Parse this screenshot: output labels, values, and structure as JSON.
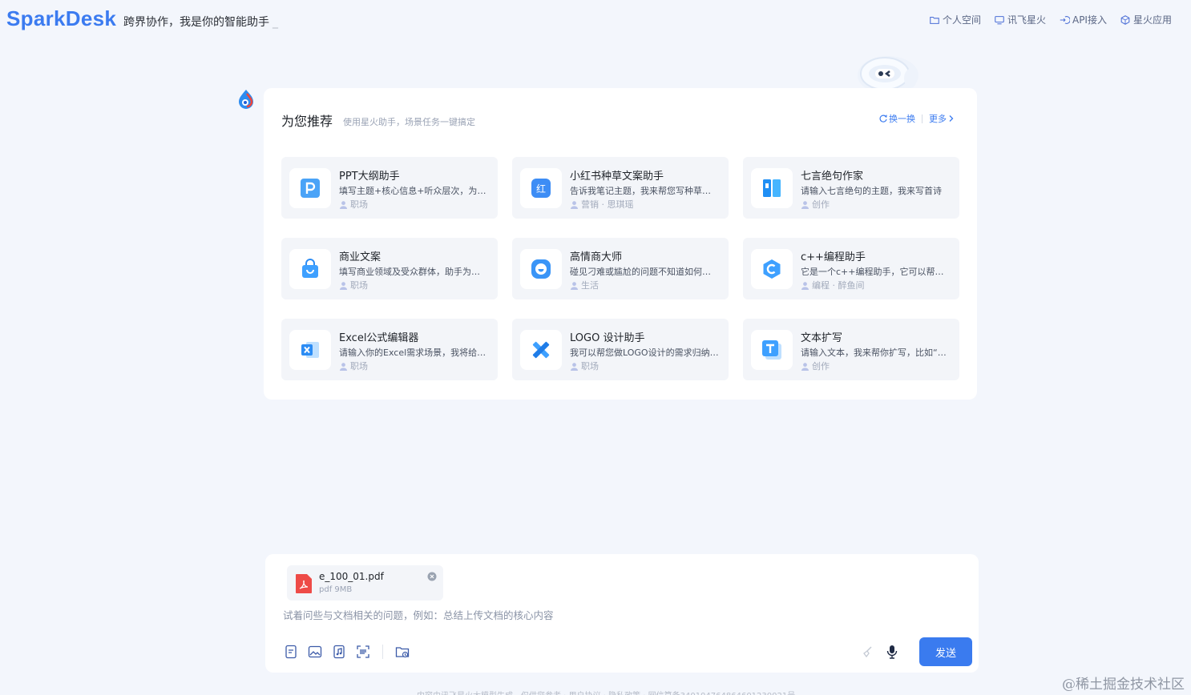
{
  "header": {
    "logo": "SparkDesk",
    "slogan": "跨界协作，我是你的智能助手",
    "cursor": "_",
    "nav": [
      {
        "label": "个人空间",
        "icon": "folder-icon"
      },
      {
        "label": "讯飞星火",
        "icon": "monitor-icon"
      },
      {
        "label": "API接入",
        "icon": "api-plug-icon"
      },
      {
        "label": "星火应用",
        "icon": "cube-icon"
      }
    ]
  },
  "recommend": {
    "title": "为您推荐",
    "subtitle": "使用星火助手，场景任务一键搞定",
    "refresh_label": "换一换",
    "more_label": "更多",
    "items": [
      {
        "name": "PPT大纲助手",
        "desc": "填写主题+核心信息+听众层次，为你生成PPT大纲",
        "tags": "职场",
        "icon": "ppt-icon"
      },
      {
        "name": "小红书种草文案助手",
        "desc": "告诉我笔记主题，我来帮您写种草文案",
        "tags": "营销 · 思琪瑶",
        "icon": "xiaohongshu-icon"
      },
      {
        "name": "七言绝句作家",
        "desc": "请输入七言绝句的主题，我来写首诗",
        "tags": "创作",
        "icon": "book-icon"
      },
      {
        "name": "商业文案",
        "desc": "填写商业领域及受众群体，助手为你生成文案",
        "tags": "职场",
        "icon": "shopping-bag-icon"
      },
      {
        "name": "高情商大师",
        "desc": "碰见刁难或尴尬的问题不知道如何回答",
        "tags": "生活",
        "icon": "smile-icon"
      },
      {
        "name": "c++编程助手",
        "desc": "它是一个c++编程助手，它可以帮你解答问题",
        "tags": "编程 · 醉鱼间",
        "icon": "cpp-icon"
      },
      {
        "name": "Excel公式编辑器",
        "desc": "请输入你的Excel需求场景，我将给出公式",
        "tags": "职场",
        "icon": "excel-icon"
      },
      {
        "name": "LOGO 设计助手",
        "desc": "我可以帮您做LOGO设计的需求归纳整理",
        "tags": "职场",
        "icon": "design-tools-icon"
      },
      {
        "name": "文本扩写",
        "desc": "请输入文本，我来帮你扩写，比如“今天天气真好”",
        "tags": "创作",
        "icon": "text-t-icon"
      }
    ]
  },
  "input": {
    "file": {
      "name": "e_100_01.pdf",
      "meta": "pdf 9MB"
    },
    "placeholder": "试着问些与文档相关的问题，例如：总结上传文档的核心内容",
    "value": "",
    "send_label": "发送",
    "tools": [
      "document-icon",
      "image-icon",
      "audio-file-icon",
      "scan-icon",
      "folder-upload-icon"
    ]
  },
  "footer": "内容由讯飞星火大模型生成，仅供您参考 · 用户协议 · 隐私政策 · 网信算备340104764864601230021号",
  "watermark": "@稀土掘金技术社区",
  "colors": {
    "accent": "#3a7bef",
    "background": "#f3f6fc",
    "card": "#ffffff",
    "tile": "#f3f5f9"
  }
}
